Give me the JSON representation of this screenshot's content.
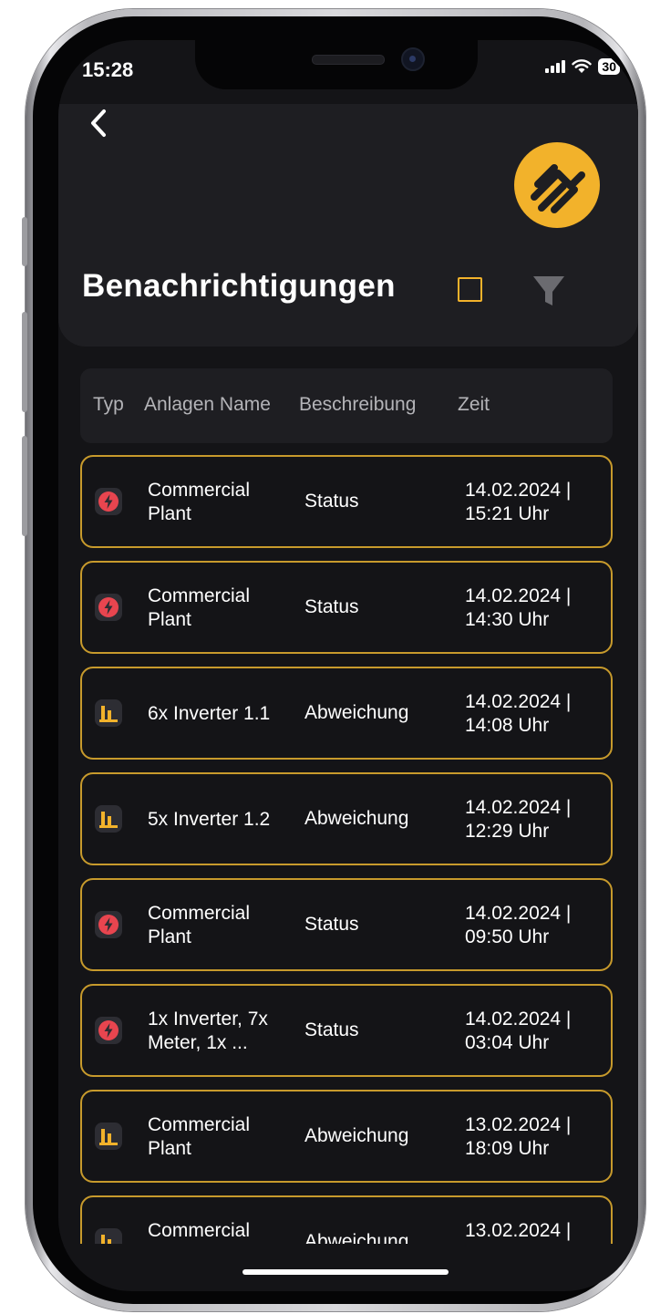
{
  "status_bar": {
    "time": "15:28",
    "battery": "30"
  },
  "header": {
    "title": "Benachrichtigungen"
  },
  "table": {
    "columns": [
      "Typ",
      "Anlagen Name",
      "Beschreibung",
      "Zeit"
    ]
  },
  "notifications": [
    {
      "type": "status",
      "name": "Commercial\nPlant",
      "description": "Status",
      "time": "14.02.2024 |\n15:21 Uhr"
    },
    {
      "type": "status",
      "name": "Commercial\nPlant",
      "description": "Status",
      "time": "14.02.2024 |\n14:30 Uhr"
    },
    {
      "type": "deviation",
      "name": "6x Inverter 1.1",
      "description": "Abweichung",
      "time": "14.02.2024 |\n14:08 Uhr"
    },
    {
      "type": "deviation",
      "name": "5x Inverter 1.2",
      "description": "Abweichung",
      "time": "14.02.2024 |\n12:29 Uhr"
    },
    {
      "type": "status",
      "name": "Commercial\nPlant",
      "description": "Status",
      "time": "14.02.2024 |\n09:50 Uhr"
    },
    {
      "type": "status",
      "name": "1x Inverter, 7x\nMeter, 1x ...",
      "description": "Status",
      "time": "14.02.2024 |\n03:04 Uhr"
    },
    {
      "type": "deviation",
      "name": "Commercial\nPlant",
      "description": "Abweichung",
      "time": "13.02.2024 |\n18:09 Uhr"
    },
    {
      "type": "deviation",
      "name": "Commercial",
      "description": "Abweichung",
      "time": "13.02.2024 |"
    }
  ],
  "icons": {
    "status": "lightning-bolt-icon",
    "deviation": "bar-chart-icon",
    "back": "chevron-left-icon",
    "filter": "filter-icon"
  },
  "colors": {
    "accent": "#f2b22b",
    "row_border": "#c79a2c",
    "status_icon": "#e8454f",
    "background": "#141417",
    "card": "#1e1e22"
  }
}
